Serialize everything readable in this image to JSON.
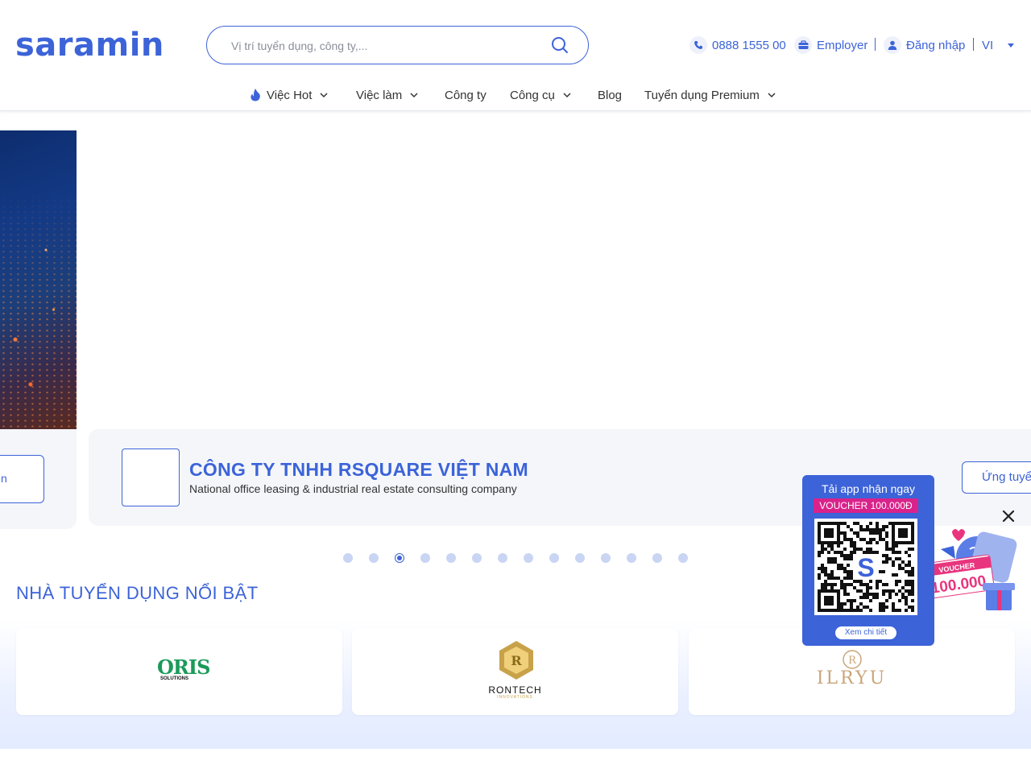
{
  "header": {
    "logo": "saramin",
    "search_placeholder": "Vị trí tuyển dụng, công ty,...",
    "phone": "0888 1555 00",
    "employer": "Employer",
    "login": "Đăng nhập",
    "lang": "VI"
  },
  "nav": {
    "items": [
      {
        "label": "Việc Hot"
      },
      {
        "label": "Việc làm"
      },
      {
        "label": "Công ty"
      },
      {
        "label": "Công cụ"
      },
      {
        "label": "Blog"
      },
      {
        "label": "Tuyển dụng Premium"
      }
    ]
  },
  "hero": {
    "left_button": "n",
    "company_name": "CÔNG TY TNHH RSQUARE VIỆT NAM",
    "company_desc": "National office leasing & industrial real estate consulting company",
    "apply": "Ứng tuyển",
    "pager_count": 14,
    "pager_active": 3
  },
  "featured": {
    "title": "NHÀ TUYỂN DỤNG NỔI BẬT",
    "employers": [
      {
        "logo_text": "ORIS",
        "logo_sub": "SOLUTIONS"
      },
      {
        "logo_text": "RONTECH",
        "logo_sub": "INNOVATIONS"
      },
      {
        "logo_text": "ILRYU",
        "logo_sub": ""
      }
    ]
  },
  "popup": {
    "title": "Tải app nhận ngay",
    "voucher": "VOUCHER 100.000Đ",
    "link": "Xem chi tiết",
    "promo_label": "VOUCHER",
    "promo_amount": "100.000"
  },
  "colors": {
    "brand": "#3c63d8",
    "voucher_pink": "#d9238b"
  }
}
